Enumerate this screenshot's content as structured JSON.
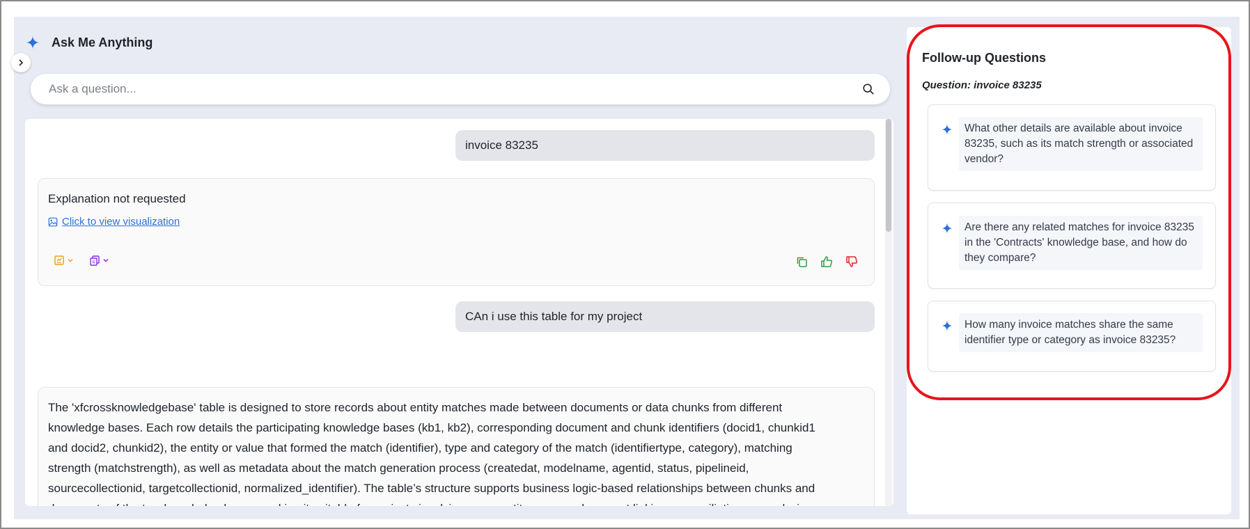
{
  "header": {
    "title": "Ask Me Anything"
  },
  "search": {
    "placeholder": "Ask a question..."
  },
  "chat": {
    "messages": [
      {
        "user": "invoice 83235",
        "answer": {
          "text": "Explanation not requested",
          "link": "Click to view visualization"
        }
      },
      {
        "user": "CAn i use this table for my project",
        "answer": {
          "lines": [
            "The 'xfcrossknowledgebase' table is designed to store records about entity matches made between documents or data chunks from different",
            "knowledge bases. Each row details the participating knowledge bases (kb1, kb2), corresponding document and chunk identifiers (docid1, chunkid1",
            "and docid2, chunkid2), the entity or value that formed the match (identifier), type and category of the match (identifiertype, category), matching",
            "strength (matchstrength), as well as metadata about the match generation process (createdat, modelname, agentid, status, pipelineid,",
            "sourcecollectionid, targetcollectionid, normalized_identifier). The table’s structure supports business logic-based relationships between chunks and",
            "documents of the two knowledge bases, making it suitable for projects involving cross-entity or cross-document linking, reconciliation, or analysis"
          ]
        }
      }
    ]
  },
  "followup": {
    "title": "Follow-up Questions",
    "question_label": "Question: invoice 83235",
    "items": [
      {
        "text": "What other details are available about invoice 83235, such as its match strength or associated vendor?"
      },
      {
        "text": "Are there any related matches for invoice 83235 in the 'Contracts' knowledge base, and how do they compare?"
      },
      {
        "text": "How many invoice matches share the same identifier type or category as invoice 83235?"
      }
    ]
  },
  "colors": {
    "accent_blue": "#2f6fdb",
    "highlight_red": "#e8141b",
    "report_icon_orange": "#f0a020",
    "copy_menu_purple": "#8a2be2",
    "feedback_green": "#2e9e3e",
    "feedback_red": "#e0242a"
  },
  "icons": {
    "sparkle": "sparkle-icon",
    "search": "search-icon",
    "collapse": "chevron-right-icon",
    "visualization": "image-icon",
    "report": "report-icon",
    "copy_menu": "copy-stack-icon",
    "copy": "copy-icon",
    "like": "thumbs-up-icon",
    "dislike": "thumbs-down-icon"
  }
}
